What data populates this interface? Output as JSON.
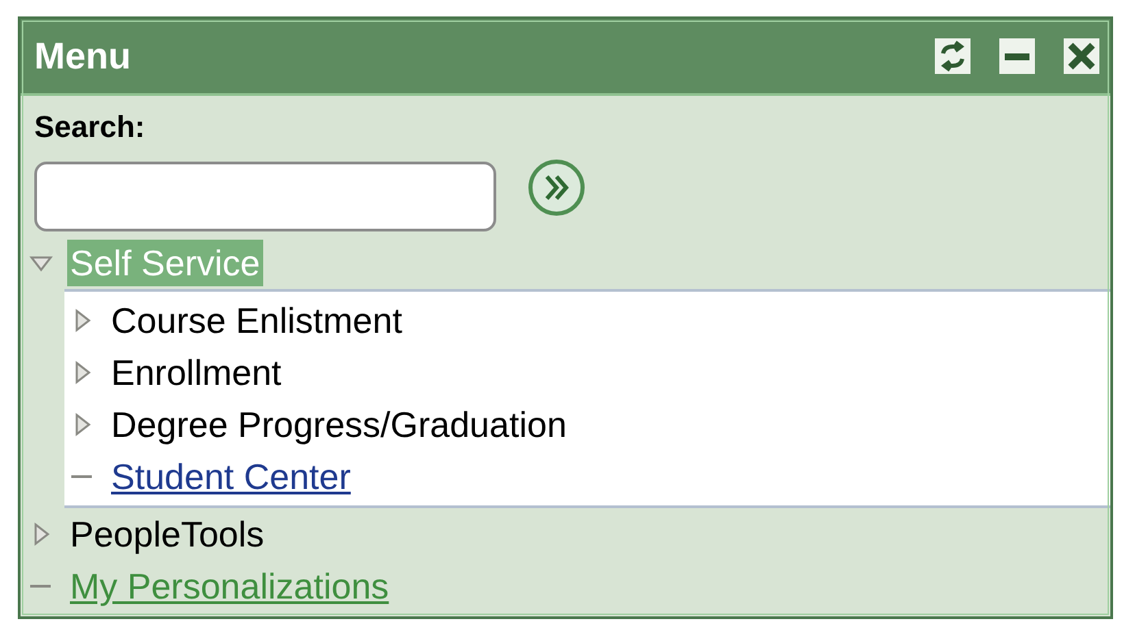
{
  "window": {
    "title": "Menu"
  },
  "title_buttons": [
    {
      "kind": "refresh"
    },
    {
      "kind": "minimize"
    },
    {
      "kind": "close"
    }
  ],
  "search": {
    "label": "Search:"
  },
  "tree": [
    {
      "kind": "folder",
      "label": "Self Service",
      "expanded": true,
      "selected": true,
      "children": [
        {
          "kind": "folder",
          "label": "Course Enlistment",
          "expanded": false,
          "selected": false
        },
        {
          "kind": "folder",
          "label": "Enrollment",
          "expanded": false,
          "selected": false
        },
        {
          "kind": "folder",
          "label": "Degree Progress/Graduation",
          "expanded": false,
          "selected": false
        },
        {
          "kind": "link",
          "label": "Student Center",
          "selected": false
        }
      ]
    },
    {
      "kind": "folder",
      "label": "PeopleTools",
      "expanded": false,
      "selected": false
    },
    {
      "kind": "link",
      "label": "My Personalizations",
      "selected": false
    }
  ]
}
